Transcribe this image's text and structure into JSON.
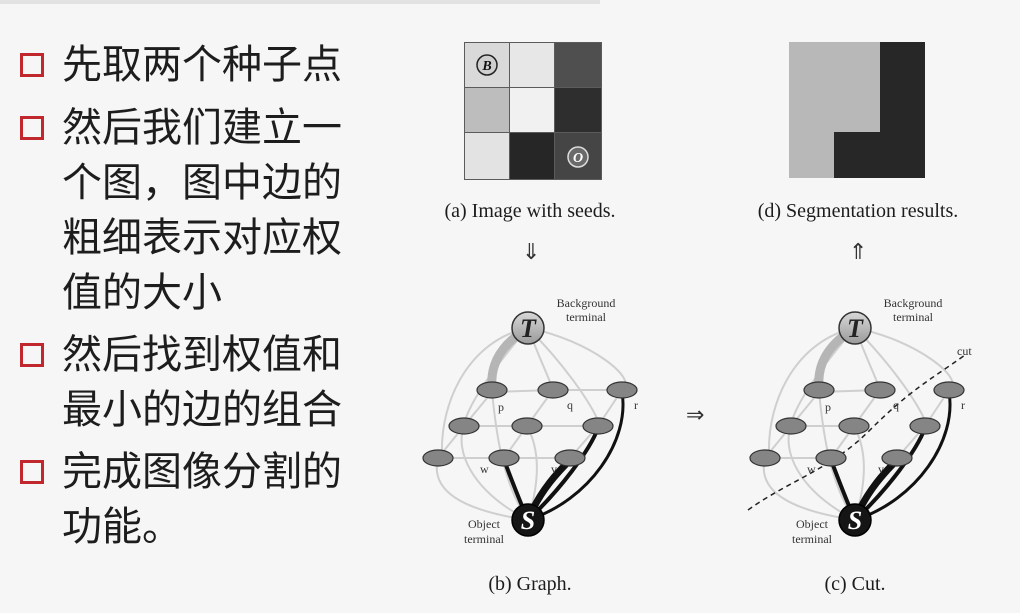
{
  "bullets": [
    "先取两个种子点",
    "然后我们建立一个图，图中边的粗细表示对应权值的大小",
    "然后找到权值和最小的边的组合",
    "完成图像分割的功能。"
  ],
  "figures": {
    "a_caption": "(a) Image with seeds.",
    "d_caption": "(d) Segmentation results.",
    "b_caption": "(b) Graph.",
    "c_caption": "(c) Cut.",
    "seed_b": "B",
    "seed_o": "O",
    "down_arrow": "⇓",
    "up_arrow": "⇑",
    "right_arrow": "⇒",
    "bg_terminal_line1": "Background",
    "bg_terminal_line2": "terminal",
    "obj_terminal_line1": "Object",
    "obj_terminal_line2": "terminal",
    "t_label": "T",
    "s_label": "S",
    "node_p": "p",
    "node_q": "q",
    "node_r": "r",
    "node_w": "w",
    "node_v": "v",
    "cut_label": "cut"
  }
}
